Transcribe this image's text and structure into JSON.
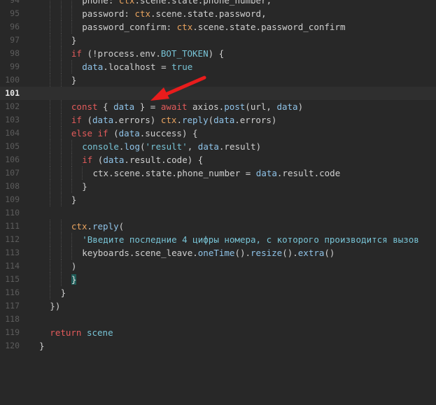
{
  "editor": {
    "lines": [
      {
        "num": "94",
        "indent": 4,
        "segments": [
          {
            "t": "phone: ",
            "c": "t"
          },
          {
            "t": "ctx",
            "c": "c"
          },
          {
            "t": ".scene.state.phone_number,",
            "c": "t"
          }
        ]
      },
      {
        "num": "95",
        "indent": 4,
        "segments": [
          {
            "t": "password: ",
            "c": "t"
          },
          {
            "t": "ctx",
            "c": "c"
          },
          {
            "t": ".scene.state.password,",
            "c": "t"
          }
        ]
      },
      {
        "num": "96",
        "indent": 4,
        "segments": [
          {
            "t": "password_confirm: ",
            "c": "t"
          },
          {
            "t": "ctx",
            "c": "c"
          },
          {
            "t": ".scene.state.password_confirm",
            "c": "t"
          }
        ]
      },
      {
        "num": "97",
        "indent": 3,
        "segments": [
          {
            "t": "}",
            "c": "t"
          }
        ]
      },
      {
        "num": "98",
        "indent": 3,
        "segments": [
          {
            "t": "if",
            "c": "k"
          },
          {
            "t": " (!",
            "c": "t"
          },
          {
            "t": "process",
            "c": "t"
          },
          {
            "t": ".env.",
            "c": "t"
          },
          {
            "t": "BOT_TOKEN",
            "c": "s"
          },
          {
            "t": ") {",
            "c": "t"
          }
        ]
      },
      {
        "num": "99",
        "indent": 4,
        "segments": [
          {
            "t": "data",
            "c": "m"
          },
          {
            "t": ".localhost = ",
            "c": "t"
          },
          {
            "t": "true",
            "c": "s"
          }
        ]
      },
      {
        "num": "100",
        "indent": 3,
        "segments": [
          {
            "t": "}",
            "c": "t"
          }
        ]
      },
      {
        "num": "101",
        "indent": 0,
        "current": true,
        "segments": []
      },
      {
        "num": "102",
        "indent": 3,
        "segments": [
          {
            "t": "const",
            "c": "k"
          },
          {
            "t": " { ",
            "c": "t"
          },
          {
            "t": "data",
            "c": "m"
          },
          {
            "t": " } = ",
            "c": "t"
          },
          {
            "t": "await",
            "c": "k"
          },
          {
            "t": " axios.",
            "c": "t"
          },
          {
            "t": "post",
            "c": "m"
          },
          {
            "t": "(url, ",
            "c": "t"
          },
          {
            "t": "data",
            "c": "m"
          },
          {
            "t": ")",
            "c": "t"
          }
        ]
      },
      {
        "num": "103",
        "indent": 3,
        "segments": [
          {
            "t": "if",
            "c": "k"
          },
          {
            "t": " (",
            "c": "t"
          },
          {
            "t": "data",
            "c": "m"
          },
          {
            "t": ".errors) ",
            "c": "t"
          },
          {
            "t": "ctx",
            "c": "c"
          },
          {
            "t": ".",
            "c": "t"
          },
          {
            "t": "reply",
            "c": "m"
          },
          {
            "t": "(",
            "c": "t"
          },
          {
            "t": "data",
            "c": "m"
          },
          {
            "t": ".errors)",
            "c": "t"
          }
        ]
      },
      {
        "num": "104",
        "indent": 3,
        "segments": [
          {
            "t": "else if",
            "c": "k"
          },
          {
            "t": " (",
            "c": "t"
          },
          {
            "t": "data",
            "c": "m"
          },
          {
            "t": ".success) {",
            "c": "t"
          }
        ]
      },
      {
        "num": "105",
        "indent": 4,
        "segments": [
          {
            "t": "console",
            "c": "s"
          },
          {
            "t": ".",
            "c": "t"
          },
          {
            "t": "log",
            "c": "m"
          },
          {
            "t": "(",
            "c": "t"
          },
          {
            "t": "'result'",
            "c": "s"
          },
          {
            "t": ", ",
            "c": "t"
          },
          {
            "t": "data",
            "c": "m"
          },
          {
            "t": ".result)",
            "c": "t"
          }
        ]
      },
      {
        "num": "106",
        "indent": 4,
        "segments": [
          {
            "t": "if",
            "c": "k"
          },
          {
            "t": " (",
            "c": "t"
          },
          {
            "t": "data",
            "c": "m"
          },
          {
            "t": ".result.code) {",
            "c": "t"
          }
        ]
      },
      {
        "num": "107",
        "indent": 5,
        "segments": [
          {
            "t": "ctx",
            "c": "t"
          },
          {
            "t": ".scene.state.phone_number = ",
            "c": "t"
          },
          {
            "t": "data",
            "c": "m"
          },
          {
            "t": ".result.code",
            "c": "t"
          }
        ]
      },
      {
        "num": "108",
        "indent": 4,
        "segments": [
          {
            "t": "}",
            "c": "t"
          }
        ]
      },
      {
        "num": "109",
        "indent": 3,
        "segments": [
          {
            "t": "}",
            "c": "t"
          }
        ]
      },
      {
        "num": "110",
        "indent": 0,
        "segments": []
      },
      {
        "num": "111",
        "indent": 3,
        "segments": [
          {
            "t": "ctx",
            "c": "c"
          },
          {
            "t": ".",
            "c": "t"
          },
          {
            "t": "reply",
            "c": "m"
          },
          {
            "t": "(",
            "c": "t"
          }
        ]
      },
      {
        "num": "112",
        "indent": 4,
        "segments": [
          {
            "t": "'Введите последние 4 цифры номера, с которого производится вызов",
            "c": "s"
          }
        ]
      },
      {
        "num": "113",
        "indent": 4,
        "segments": [
          {
            "t": "keyboards.scene_leave.",
            "c": "t"
          },
          {
            "t": "oneTime",
            "c": "m"
          },
          {
            "t": "().",
            "c": "t"
          },
          {
            "t": "resize",
            "c": "m"
          },
          {
            "t": "().",
            "c": "t"
          },
          {
            "t": "extra",
            "c": "m"
          },
          {
            "t": "()",
            "c": "t"
          }
        ]
      },
      {
        "num": "114",
        "indent": 3,
        "segments": [
          {
            "t": ")",
            "c": "t"
          }
        ]
      },
      {
        "num": "115",
        "indent": 3,
        "segments": [
          {
            "t": "}",
            "c": "brace-hl"
          }
        ]
      },
      {
        "num": "116",
        "indent": 2,
        "segments": [
          {
            "t": "}",
            "c": "t"
          }
        ]
      },
      {
        "num": "117",
        "indent": 1,
        "segments": [
          {
            "t": "})",
            "c": "t"
          }
        ]
      },
      {
        "num": "118",
        "indent": 0,
        "segments": []
      },
      {
        "num": "119",
        "indent": 1,
        "segments": [
          {
            "t": "return",
            "c": "k"
          },
          {
            "t": " scene",
            "c": "s"
          }
        ]
      },
      {
        "num": "120",
        "indent": 0,
        "segments": [
          {
            "t": "}",
            "c": "t"
          }
        ]
      }
    ]
  },
  "colors": {
    "background": "#282828",
    "current_line": "#2f2f2f",
    "keyword": "#e35b5b",
    "method": "#8fc3e8",
    "string": "#78c4d6",
    "ctx": "#e8a35f",
    "annotation_arrow": "#e81c1c"
  },
  "icons": {
    "annotation": "red-arrow-icon"
  }
}
